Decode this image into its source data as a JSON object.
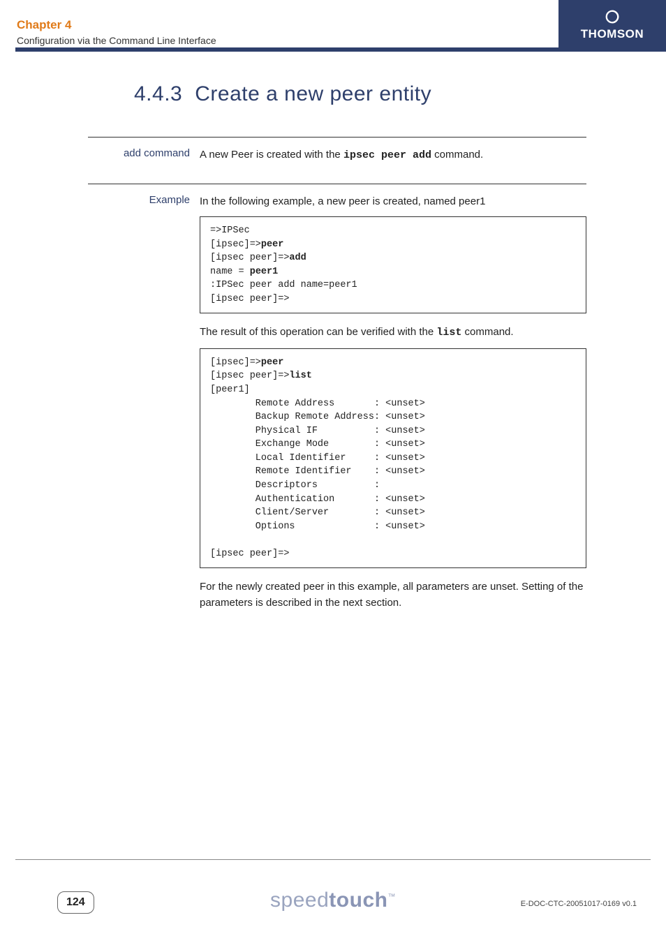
{
  "header": {
    "chapter_title": "Chapter 4",
    "chapter_sub": "Configuration via the Command Line Interface",
    "brand": "THOMSON"
  },
  "section": {
    "number": "4.4.3",
    "title": "Create a new peer entity"
  },
  "rows": {
    "add_command": {
      "label": "add command",
      "text_pre": "A new Peer is created with the ",
      "code": "ipsec peer add",
      "text_post": " command."
    },
    "example": {
      "label": "Example",
      "intro": "In the following example, a new peer is created, named peer1",
      "after_block1_pre": "The result of this operation can be verified with the ",
      "after_block1_code": "list",
      "after_block1_post": " command.",
      "conclusion": "For the newly created peer in this example, all parameters are unset. Setting of the parameters is described in the next section."
    }
  },
  "code1": {
    "l1a": "=>IPSec",
    "l2a": "[ipsec]=>",
    "l2b": "peer",
    "l3a": "[ipsec peer]=>",
    "l3b": "add",
    "l4a": "name = ",
    "l4b": "peer1",
    "l5": ":IPSec peer add name=peer1",
    "l6": "[ipsec peer]=>"
  },
  "code2": {
    "l1a": "[ipsec]=>",
    "l1b": "peer",
    "l2a": "[ipsec peer]=>",
    "l2b": "list",
    "l3": "[peer1]",
    "l4": "        Remote Address       : <unset>",
    "l5": "        Backup Remote Address: <unset>",
    "l6": "        Physical IF          : <unset>",
    "l7": "        Exchange Mode        : <unset>",
    "l8": "        Local Identifier     : <unset>",
    "l9": "        Remote Identifier    : <unset>",
    "l10": "        Descriptors          :",
    "l11": "        Authentication       : <unset>",
    "l12": "        Client/Server        : <unset>",
    "l13": "        Options              : <unset>",
    "l14": "",
    "l15": "[ipsec peer]=>"
  },
  "footer": {
    "page": "124",
    "brand_light": "speed",
    "brand_bold": "touch",
    "tm": "™",
    "doc_id": "E-DOC-CTC-20051017-0169 v0.1"
  }
}
